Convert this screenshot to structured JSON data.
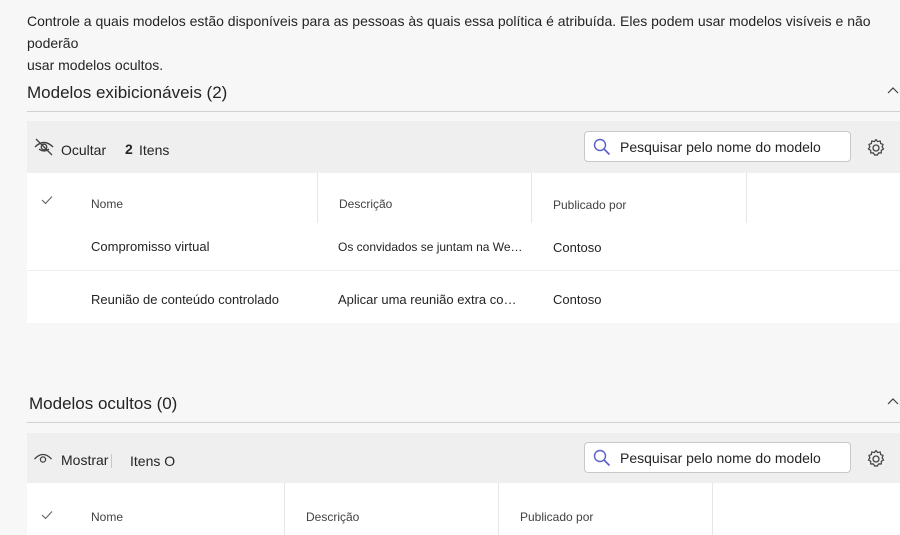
{
  "intro": {
    "line1": "Controle a quais modelos estão disponíveis para as pessoas às quais essa política é atribuída. Eles podem usar modelos visíveis e não poderão",
    "line2": "usar modelos ocultos."
  },
  "visible_section": {
    "title": "Modelos exibicionáveis (2)",
    "toolbar": {
      "action_label": "Ocultar",
      "count_number": "2",
      "count_label": "Itens",
      "search_placeholder": "Pesquisar pelo nome do modelo"
    },
    "columns": [
      "Nome",
      "Descrição",
      "Publicado por"
    ],
    "rows": [
      {
        "name": "Compromisso virtual",
        "description": "Os convidados se juntam na Web e…",
        "publisher": "Contoso"
      },
      {
        "name": "Reunião de conteúdo controlado",
        "description": "Aplicar uma reunião extra co…",
        "publisher": "Contoso"
      }
    ]
  },
  "hidden_section": {
    "title": "Modelos ocultos (0)",
    "toolbar": {
      "action_label": "Mostrar",
      "count_label": "Itens O",
      "search_placeholder": "Pesquisar pelo nome do modelo"
    },
    "columns": [
      "Nome",
      "Descrição",
      "Publicado por"
    ]
  },
  "icons": {
    "hide": "eye-off-icon",
    "show": "eye-icon",
    "search": "search-icon",
    "settings": "gear-icon",
    "collapse": "chevron-up-icon",
    "select_all": "checkmark-icon"
  },
  "colors": {
    "search_icon": "#5b5fc7",
    "text": "#242424"
  }
}
